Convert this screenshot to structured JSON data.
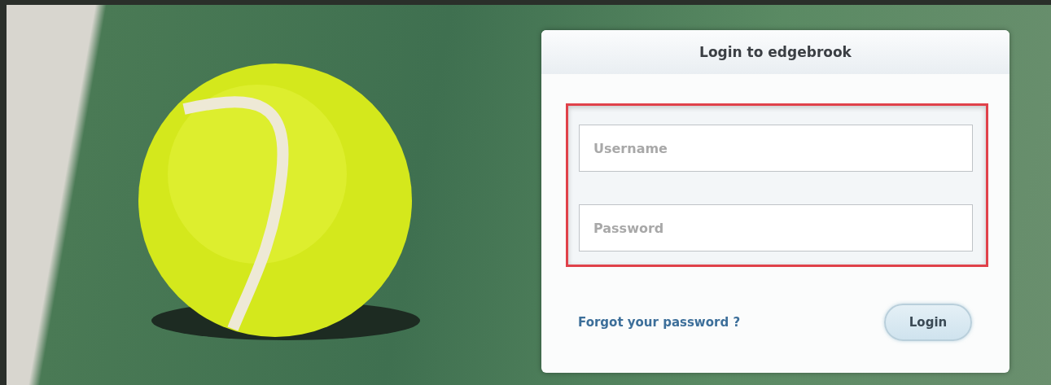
{
  "login_card": {
    "title": "Login to edgebrook",
    "fields": [
      {
        "placeholder": "Username"
      },
      {
        "placeholder": "Password"
      }
    ],
    "forgot_link": "Forgot your password ?",
    "login_button": "Login"
  }
}
